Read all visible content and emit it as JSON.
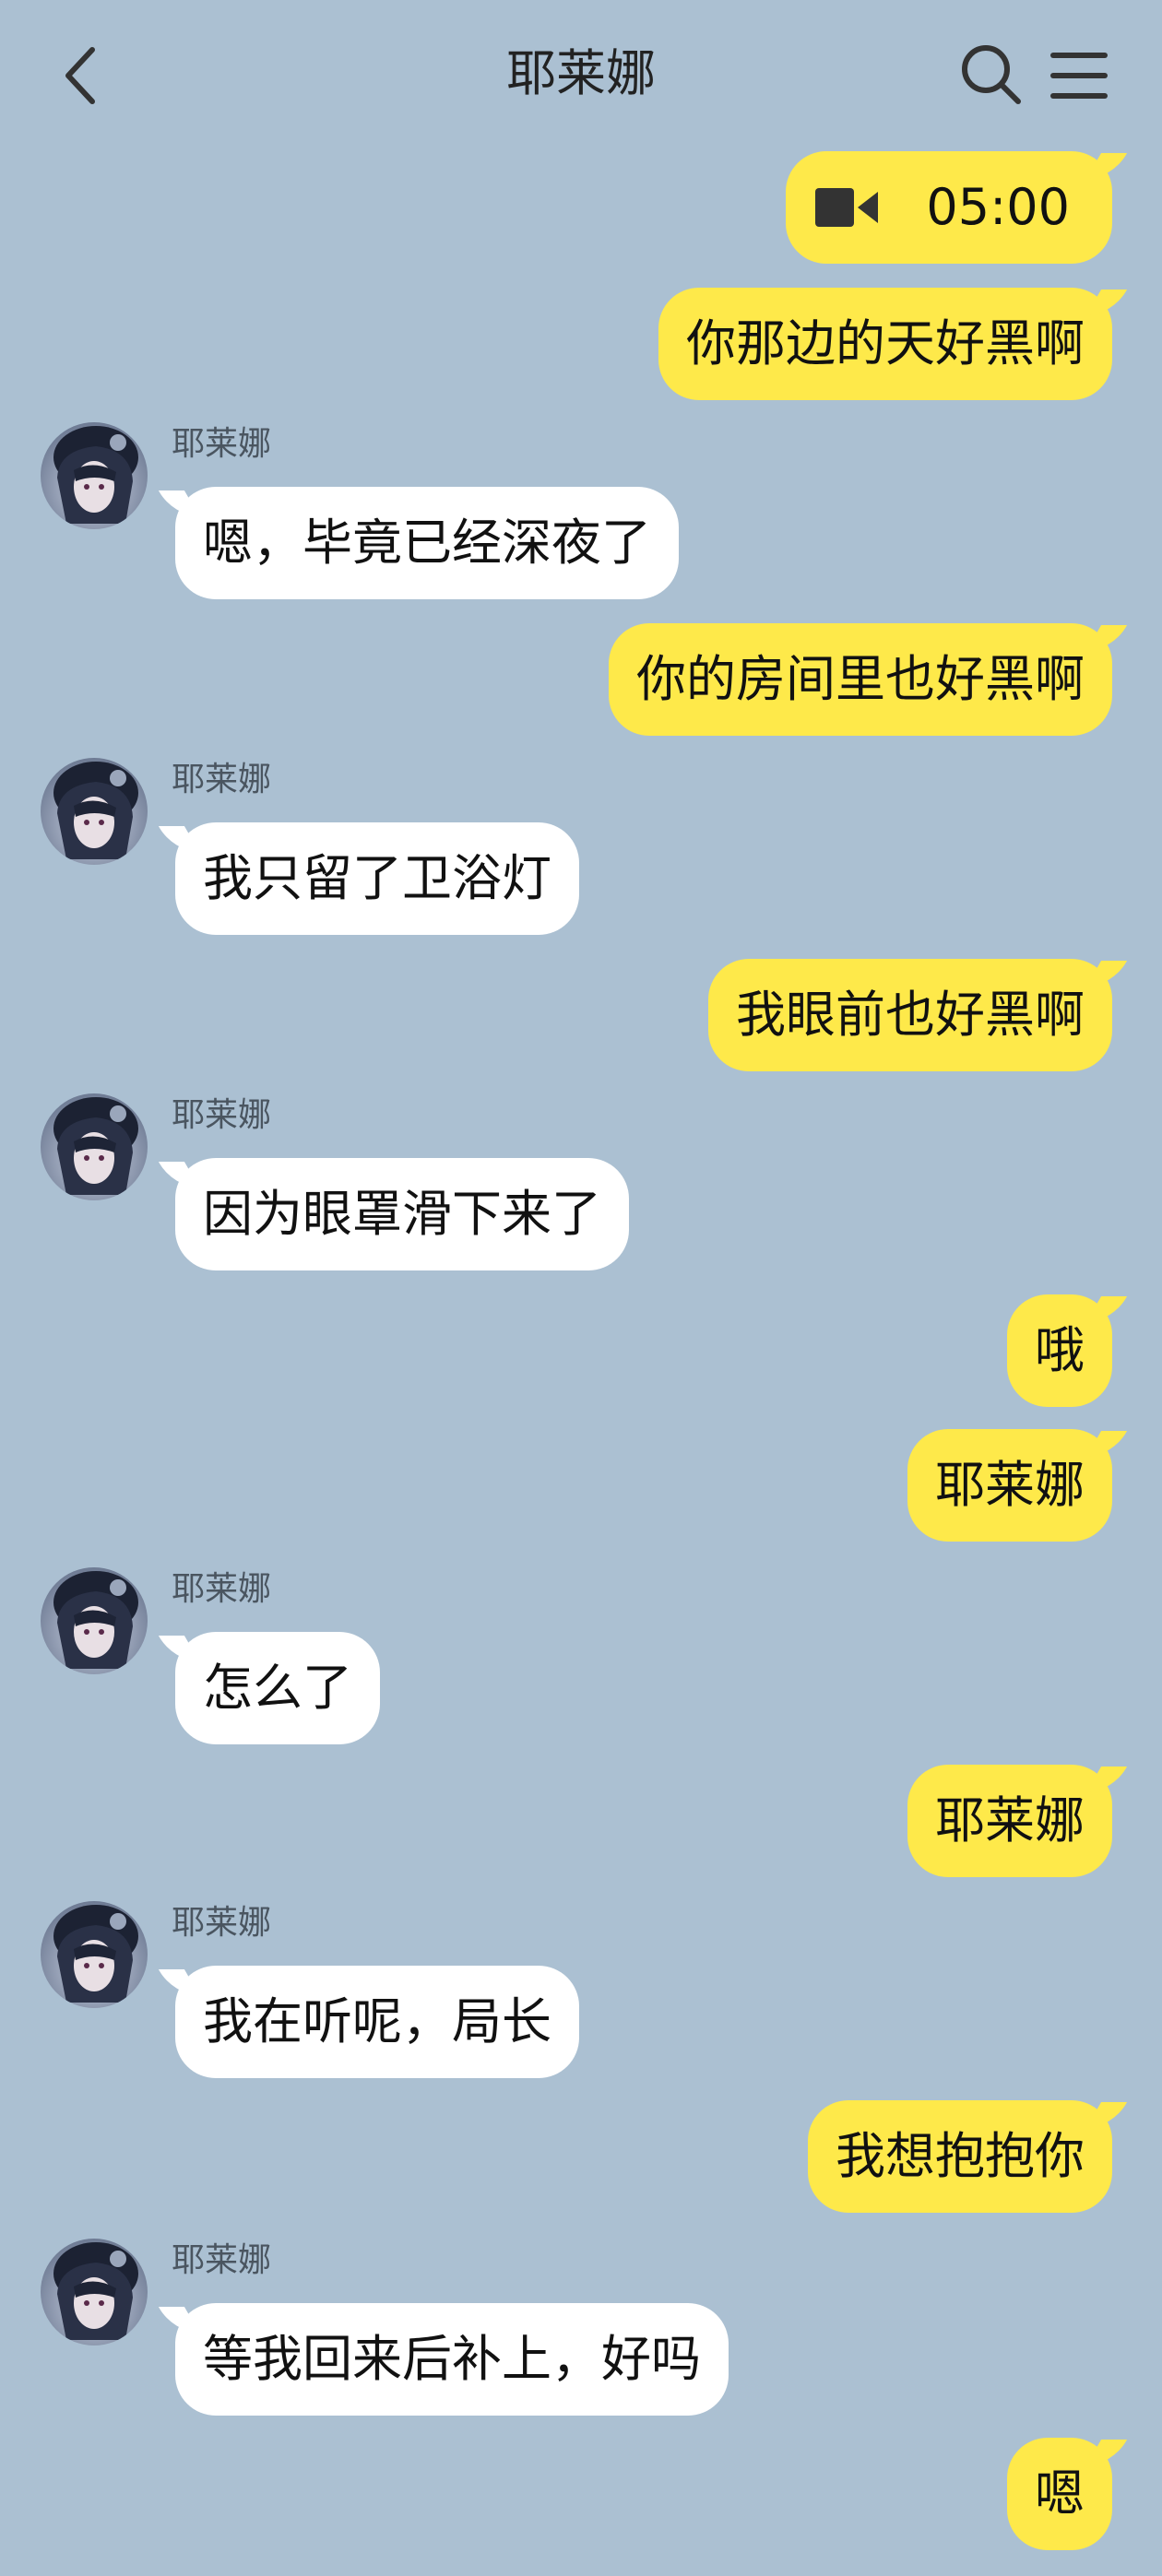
{
  "header": {
    "title": "耶莱娜",
    "back_icon": "chevron-left-icon",
    "search_icon": "search-icon",
    "menu_icon": "hamburger-menu-icon"
  },
  "contact": {
    "name": "耶莱娜"
  },
  "colors": {
    "background": "#abc0d2",
    "incoming_bubble": "#ffffff",
    "outgoing_bubble": "#fee94a"
  },
  "messages": [
    {
      "side": "out",
      "type": "video_call",
      "icon": "video-camera-icon",
      "text": "05:00"
    },
    {
      "side": "out",
      "text": "你那边的天好黑啊"
    },
    {
      "side": "in",
      "sender": "耶莱娜",
      "text": "嗯，毕竟已经深夜了"
    },
    {
      "side": "out",
      "text": "你的房间里也好黑啊"
    },
    {
      "side": "in",
      "sender": "耶莱娜",
      "text": "我只留了卫浴灯"
    },
    {
      "side": "out",
      "text": "我眼前也好黑啊"
    },
    {
      "side": "in",
      "sender": "耶莱娜",
      "text": "因为眼罩滑下来了"
    },
    {
      "side": "out",
      "text": "哦"
    },
    {
      "side": "out",
      "text": "耶莱娜"
    },
    {
      "side": "in",
      "sender": "耶莱娜",
      "text": "怎么了"
    },
    {
      "side": "out",
      "text": "耶莱娜"
    },
    {
      "side": "in",
      "sender": "耶莱娜",
      "text": "我在听呢，局长"
    },
    {
      "side": "out",
      "text": "我想抱抱你"
    },
    {
      "side": "in",
      "sender": "耶莱娜",
      "text": "等我回来后补上，好吗"
    },
    {
      "side": "out",
      "text": "嗯"
    }
  ]
}
